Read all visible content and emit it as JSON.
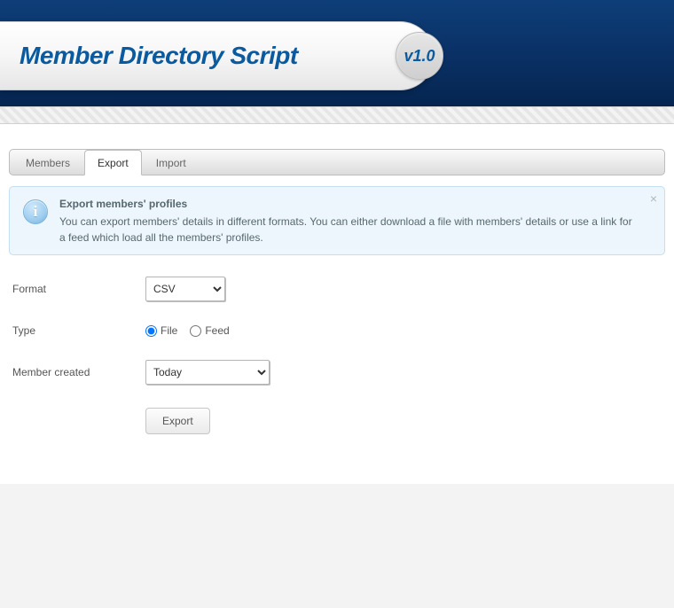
{
  "header": {
    "title": "Member Directory Script",
    "version": "v1.0"
  },
  "tabs": [
    {
      "label": "Members",
      "active": false
    },
    {
      "label": "Export",
      "active": true
    },
    {
      "label": "Import",
      "active": false
    }
  ],
  "info": {
    "title": "Export members' profiles",
    "body": "You can export members' details in different formats. You can either download a file with members' details or use a link for a feed which load all the members' profiles."
  },
  "form": {
    "format": {
      "label": "Format",
      "selected": "CSV",
      "options": [
        "CSV"
      ]
    },
    "type": {
      "label": "Type",
      "selected": "File",
      "options": [
        "File",
        "Feed"
      ]
    },
    "created": {
      "label": "Member created",
      "selected": "Today",
      "options": [
        "Today"
      ]
    },
    "submit_label": "Export"
  }
}
